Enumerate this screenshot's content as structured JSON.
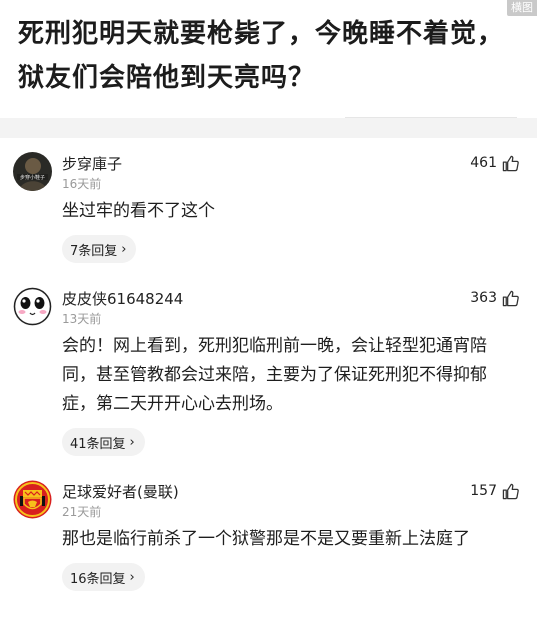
{
  "watermark": "横图",
  "question": {
    "title": "死刑犯明天就要枪毙了，今晚睡不着觉，狱友们会陪他到天亮吗？"
  },
  "comments": [
    {
      "author": "步穿庫子",
      "time": "16天前",
      "likes": "461",
      "text": "坐过牢的看不了这个",
      "replies": "7条回复",
      "avatar_icon": "dark-photo-avatar"
    },
    {
      "author": "皮皮侠61648244",
      "time": "13天前",
      "likes": "363",
      "text": "会的！网上看到，死刑犯临刑前一晚，会让轻型犯通宵陪同，甚至管教都会过来陪，主要为了保证死刑犯不得抑郁症，第二天开开心心去刑场。",
      "replies": "41条回复",
      "avatar_icon": "cartoon-face-avatar"
    },
    {
      "author": "足球爱好者(曼联)",
      "time": "21天前",
      "likes": "157",
      "text": "那也是临行前杀了一个狱警那是不是又要重新上法庭了",
      "replies": "16条回复",
      "avatar_icon": "manchester-united-crest-avatar"
    }
  ],
  "colors": {
    "accent_red": "#d8201f",
    "crest_yellow": "#f7c21b",
    "muted_text": "#9a9a9a"
  }
}
